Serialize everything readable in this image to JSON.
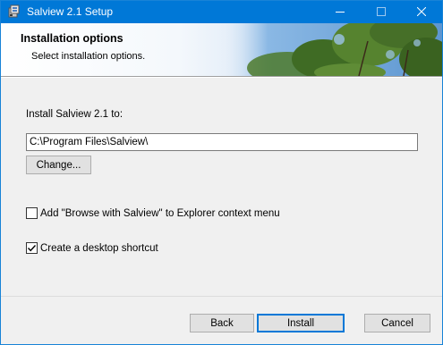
{
  "window": {
    "title": "Salview 2.1 Setup",
    "accent_color": "#0078d7"
  },
  "banner": {
    "title": "Installation options",
    "subtitle": "Select installation options."
  },
  "install": {
    "label": "Install Salview 2.1 to:",
    "path": "C:\\Program Files\\Salview\\",
    "change_label": "Change..."
  },
  "options": {
    "context_menu_label": "Add \"Browse with Salview\" to Explorer context menu",
    "context_menu_checked": false,
    "shortcut_label": "Create a desktop shortcut",
    "shortcut_checked": true
  },
  "footer": {
    "back_label": "Back",
    "install_label": "Install",
    "cancel_label": "Cancel"
  },
  "icons": {
    "app": "installer-icon",
    "minimize": "minimize-icon",
    "maximize": "maximize-icon",
    "close": "close-icon",
    "check": "checkmark-icon"
  }
}
